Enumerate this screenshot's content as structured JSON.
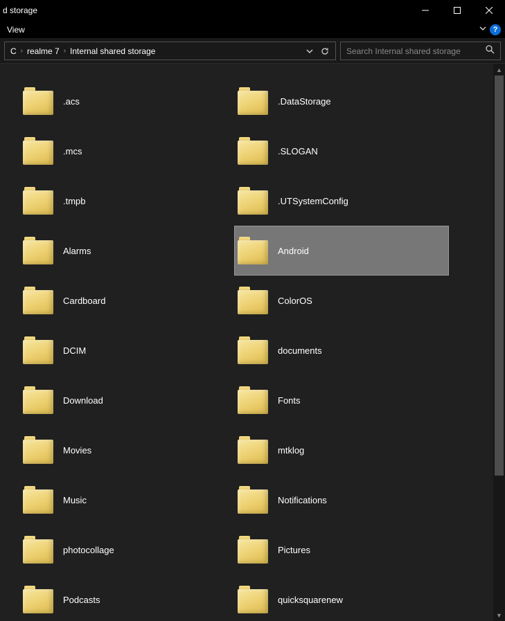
{
  "titlebar": {
    "title": "d storage"
  },
  "menu": {
    "view": "View"
  },
  "breadcrumbs": {
    "c0": "C",
    "c1": "realme 7",
    "c2": "Internal shared storage"
  },
  "search": {
    "placeholder": "Search Internal shared storage"
  },
  "folders": {
    "col1": {
      "f0": ".acs",
      "f1": ".mcs",
      "f2": ".tmpb",
      "f3": "Alarms",
      "f4": "Cardboard",
      "f5": "DCIM",
      "f6": "Download",
      "f7": "Movies",
      "f8": "Music",
      "f9": "photocollage",
      "f10": "Podcasts"
    },
    "col2": {
      "f0": ".DataStorage",
      "f1": ".SLOGAN",
      "f2": ".UTSystemConfig",
      "f3": "Android",
      "f4": "ColorOS",
      "f5": "documents",
      "f6": "Fonts",
      "f7": "mtklog",
      "f8": "Notifications",
      "f9": "Pictures",
      "f10": "quicksquarenew"
    }
  },
  "selected": "Android"
}
